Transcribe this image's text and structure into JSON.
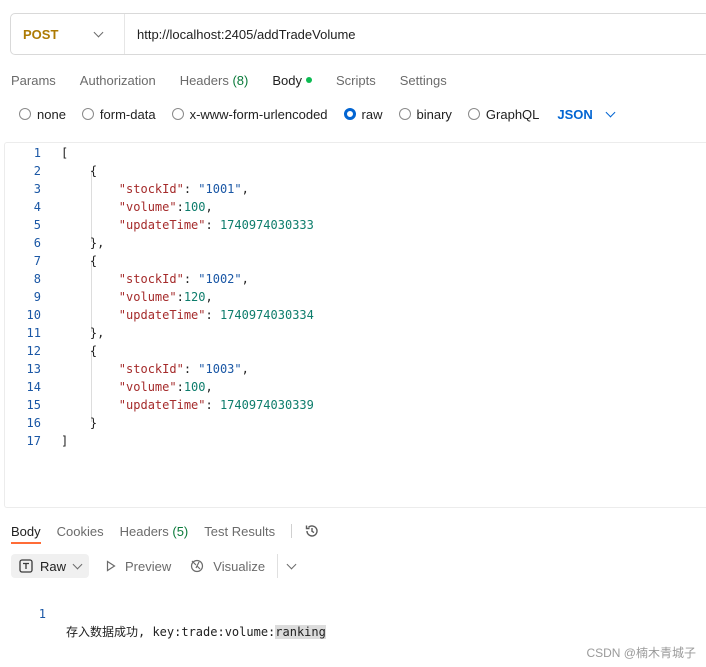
{
  "request": {
    "method": "POST",
    "url": "http://localhost:2405/addTradeVolume"
  },
  "tabs": {
    "params": "Params",
    "authorization": "Authorization",
    "headers": "Headers",
    "headers_count": "(8)",
    "body": "Body",
    "scripts": "Scripts",
    "settings": "Settings"
  },
  "body_options": {
    "none": "none",
    "form_data": "form-data",
    "urlencoded": "x-www-form-urlencoded",
    "raw": "raw",
    "binary": "binary",
    "graphql": "GraphQL",
    "selected": "raw",
    "language": "JSON"
  },
  "editor": {
    "lines": [
      {
        "n": "1",
        "tokens": [
          [
            "p",
            "["
          ]
        ]
      },
      {
        "n": "2",
        "tokens": [
          [
            "p",
            "    {"
          ]
        ]
      },
      {
        "n": "3",
        "tokens": [
          [
            "p",
            "        "
          ],
          [
            "k",
            "\"stockId\""
          ],
          [
            "p",
            ": "
          ],
          [
            "s",
            "\"1001\""
          ],
          [
            "p",
            ","
          ]
        ]
      },
      {
        "n": "4",
        "tokens": [
          [
            "p",
            "        "
          ],
          [
            "k",
            "\"volume\""
          ],
          [
            "p",
            ":"
          ],
          [
            "n",
            "100"
          ],
          [
            "p",
            ","
          ]
        ]
      },
      {
        "n": "5",
        "tokens": [
          [
            "p",
            "        "
          ],
          [
            "k",
            "\"updateTime\""
          ],
          [
            "p",
            ": "
          ],
          [
            "n",
            "1740974030333"
          ]
        ]
      },
      {
        "n": "6",
        "tokens": [
          [
            "p",
            "    },"
          ]
        ]
      },
      {
        "n": "7",
        "tokens": [
          [
            "p",
            "    {"
          ]
        ]
      },
      {
        "n": "8",
        "tokens": [
          [
            "p",
            "        "
          ],
          [
            "k",
            "\"stockId\""
          ],
          [
            "p",
            ": "
          ],
          [
            "s",
            "\"1002\""
          ],
          [
            "p",
            ","
          ]
        ]
      },
      {
        "n": "9",
        "tokens": [
          [
            "p",
            "        "
          ],
          [
            "k",
            "\"volume\""
          ],
          [
            "p",
            ":"
          ],
          [
            "n",
            "120"
          ],
          [
            "p",
            ","
          ]
        ]
      },
      {
        "n": "10",
        "tokens": [
          [
            "p",
            "        "
          ],
          [
            "k",
            "\"updateTime\""
          ],
          [
            "p",
            ": "
          ],
          [
            "n",
            "1740974030334"
          ]
        ]
      },
      {
        "n": "11",
        "tokens": [
          [
            "p",
            "    },"
          ]
        ]
      },
      {
        "n": "12",
        "tokens": [
          [
            "p",
            "    {"
          ]
        ]
      },
      {
        "n": "13",
        "tokens": [
          [
            "p",
            "        "
          ],
          [
            "k",
            "\"stockId\""
          ],
          [
            "p",
            ": "
          ],
          [
            "s",
            "\"1003\""
          ],
          [
            "p",
            ","
          ]
        ]
      },
      {
        "n": "14",
        "tokens": [
          [
            "p",
            "        "
          ],
          [
            "k",
            "\"volume\""
          ],
          [
            "p",
            ":"
          ],
          [
            "n",
            "100"
          ],
          [
            "p",
            ","
          ]
        ]
      },
      {
        "n": "15",
        "tokens": [
          [
            "p",
            "        "
          ],
          [
            "k",
            "\"updateTime\""
          ],
          [
            "p",
            ": "
          ],
          [
            "n",
            "1740974030339"
          ]
        ]
      },
      {
        "n": "16",
        "tokens": [
          [
            "p",
            "    }"
          ]
        ]
      },
      {
        "n": "17",
        "tokens": [
          [
            "p",
            "]"
          ]
        ]
      }
    ]
  },
  "response": {
    "tabs": {
      "body": "Body",
      "cookies": "Cookies",
      "headers": "Headers",
      "headers_count": "(5)",
      "test_results": "Test Results"
    },
    "format": "Raw",
    "preview": "Preview",
    "visualize": "Visualize",
    "line_number": "1",
    "text": "存入数据成功, key:trade:volume:",
    "highlighted": "ranking"
  },
  "watermark": "CSDN @楠木青城子",
  "colors": {
    "method": "#ad7a03",
    "accent_blue": "#0265d2",
    "active_tab_underline": "#ff6c37",
    "body_dot": "#0cbb52",
    "json_key": "#a52b2b",
    "json_string": "#1a57a5",
    "json_number": "#0d7d6c"
  }
}
